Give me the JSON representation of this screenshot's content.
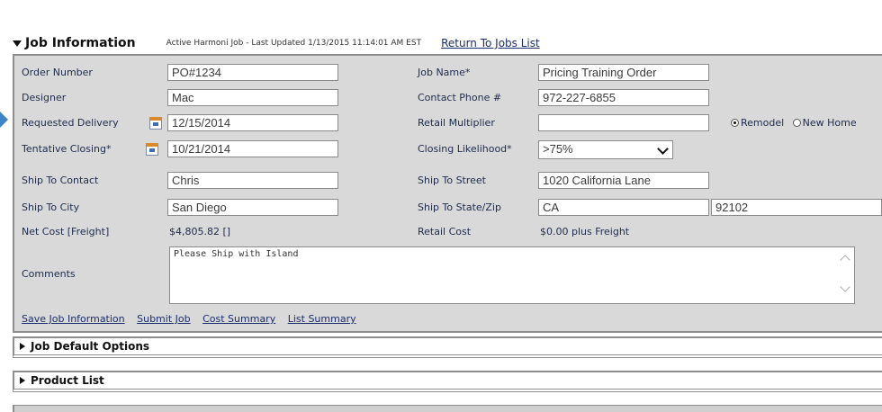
{
  "header": {
    "title": "Job Information",
    "meta": "Active Harmoni Job - Last Updated 1/13/2015 11:14:01 AM EST",
    "return_link": "Return To Jobs List"
  },
  "form": {
    "order_number": {
      "label": "Order Number",
      "value": "PO#1234"
    },
    "designer": {
      "label": "Designer",
      "value": "Mac"
    },
    "requested_delivery": {
      "label": "Requested Delivery",
      "value": "12/15/2014"
    },
    "tentative_closing": {
      "label": "Tentative Closing*",
      "value": "10/21/2014"
    },
    "ship_to_contact": {
      "label": "Ship To Contact",
      "value": "Chris"
    },
    "ship_to_city": {
      "label": "Ship To City",
      "value": "San Diego"
    },
    "net_cost": {
      "label": "Net Cost [Freight]",
      "value": "$4,805.82  []"
    },
    "comments": {
      "label": "Comments",
      "value": "Please Ship with Island"
    },
    "job_name": {
      "label": "Job Name*",
      "value": "Pricing Training Order"
    },
    "contact_phone": {
      "label": "Contact Phone #",
      "value": "972-227-6855"
    },
    "retail_multiplier": {
      "label": "Retail Multiplier",
      "value": ""
    },
    "closing_likelihood": {
      "label": "Closing Likelihood*",
      "value": ">75%"
    },
    "ship_to_street": {
      "label": "Ship To Street",
      "value": "1020 California Lane"
    },
    "ship_to_state_zip": {
      "label": "Ship To State/Zip",
      "state": "CA",
      "zip": "92102"
    },
    "retail_cost": {
      "label": "Retail Cost",
      "value": "$0.00 plus Freight"
    },
    "job_type": {
      "options": [
        "Remodel",
        "New Home"
      ],
      "selected": "Remodel"
    }
  },
  "actions": {
    "save": "Save Job Information",
    "submit": "Submit Job",
    "cost_summary": "Cost Summary",
    "list_summary": "List Summary"
  },
  "sections": {
    "job_default_options": "Job Default Options",
    "product_list": "Product List"
  },
  "colors": {
    "panel_bg": "#d9d9d9",
    "link": "#1a2d6e",
    "label": "#1f2b4d",
    "accent_arrow": "#3a86c8"
  }
}
